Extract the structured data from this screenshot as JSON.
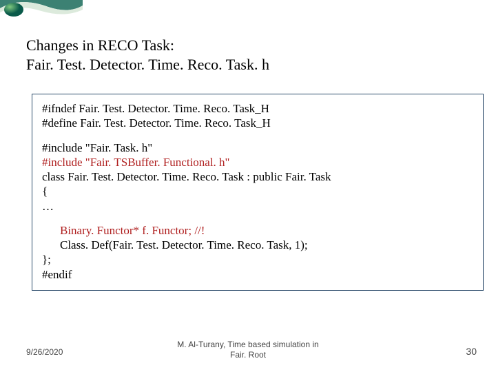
{
  "title": {
    "line1": "Changes in RECO Task:",
    "line2": "Fair. Test. Detector. Time. Reco. Task. h"
  },
  "code": {
    "block1": {
      "l1": "#ifndef Fair. Test. Detector. Time. Reco. Task_H",
      "l2": "#define Fair. Test. Detector. Time. Reco. Task_H"
    },
    "block2": {
      "l1": "#include \"Fair. Task. h\"",
      "l2": "#include \"Fair. TSBuffer. Functional. h\"",
      "l3": "class Fair. Test. Detector. Time. Reco. Task : public Fair. Task",
      "l4": "{",
      "l5": "…"
    },
    "block3": {
      "l1": "Binary. Functor* f. Functor; //!",
      "l2": "Class. Def(Fair. Test. Detector. Time. Reco. Task, 1);",
      "l3": "};",
      "l4": "#endif"
    }
  },
  "footer": {
    "date": "9/26/2020",
    "center1": "M. Al-Turany, Time based simulation in",
    "center2": "Fair. Root",
    "page": "30"
  }
}
